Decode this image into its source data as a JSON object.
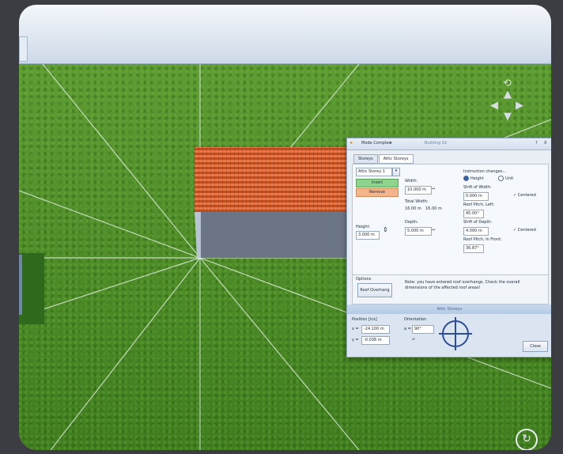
{
  "dialog": {
    "menu": "Mode Complex",
    "title": "Building 02",
    "help": "?",
    "close_x": "X",
    "tabs": [
      "Storeys",
      "Attic Storeys"
    ],
    "selected_storey": "Attic Storey 1",
    "insert_label": "Insert",
    "remove_label": "Remove",
    "height_label": "Height:",
    "height_value": "3.000 m",
    "width_label": "Width:",
    "width_value": "10.000 m",
    "total_width_label": "Total Width:",
    "total_width_values": [
      "16.00 m",
      "16.00 m"
    ],
    "depth_label": "Depth:",
    "depth_value": "5.000 m",
    "instruction_label": "Instruction changes...",
    "radio_height": "Height",
    "radio_unit": "Unit",
    "shift_width_label": "Shift of Width:",
    "shift_width_value": "0.000 m",
    "centered1": "Centered",
    "roof_pitch_left_label": "Roof Pitch, Left:",
    "roof_pitch_left_value": "45.00°",
    "shift_depth_label": "Shift of Depth:",
    "shift_depth_value": "4.000 m",
    "centered2": "Centered",
    "roof_pitch_front_label": "Roof Pitch, In Front:",
    "roof_pitch_front_value": "36.87°",
    "options_label": "Options",
    "roof_overhang_button": "Roof Overhang",
    "note": "Note: you have entered roof overhangs. Check the overall dimensions of the affected roof areas!",
    "section_title": "Attic Storeys",
    "position_label": "Position [ics]",
    "x_label": "x =",
    "x_value": "-24.100 m",
    "y_label": "y =",
    "y_value": "-0.038 m",
    "orientation_label": "Orientation",
    "angle_label": "a =",
    "angle_value": "90°",
    "close_button": "Close"
  }
}
